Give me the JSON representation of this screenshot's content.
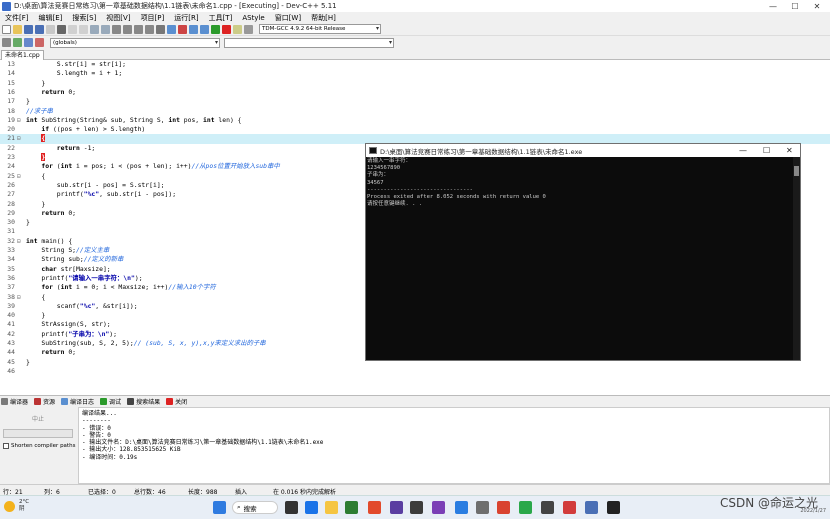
{
  "window": {
    "title": "D:\\桌面\\算法竞赛日常练习\\第一章基础数据结构\\1.1链表\\未命名1.cpp - [Executing] - Dev-C++ 5.11",
    "minimize": "—",
    "maximize": "☐",
    "close": "✕"
  },
  "menu": [
    "文件[F]",
    "编辑[E]",
    "搜索[S]",
    "视图[V]",
    "项目[P]",
    "运行[R]",
    "工具[T]",
    "AStyle",
    "窗口[W]",
    "帮助[H]"
  ],
  "toolbar": {
    "compiler_select": "TDM-GCC 4.9.2 64-bit Release",
    "scope_select": "(globals)"
  },
  "editor_tab": "未命名1.cpp",
  "code_lines": [
    {
      "n": "13",
      "f": "",
      "segs": [
        {
          "t": "        S.str[i] = str[i];",
          "c": ""
        }
      ]
    },
    {
      "n": "14",
      "f": "",
      "segs": [
        {
          "t": "        S.length = i + 1;",
          "c": ""
        }
      ]
    },
    {
      "n": "15",
      "f": "",
      "segs": [
        {
          "t": "    }",
          "c": ""
        }
      ]
    },
    {
      "n": "16",
      "f": "",
      "segs": [
        {
          "t": "    ",
          "c": ""
        },
        {
          "t": "return",
          "c": "kw"
        },
        {
          "t": " 0;",
          "c": ""
        }
      ]
    },
    {
      "n": "17",
      "f": "",
      "segs": [
        {
          "t": "}",
          "c": ""
        }
      ]
    },
    {
      "n": "18",
      "f": "",
      "segs": [
        {
          "t": "//求子串",
          "c": "cm"
        }
      ]
    },
    {
      "n": "19",
      "f": "⊟",
      "segs": [
        {
          "t": "int",
          "c": "kw"
        },
        {
          "t": " SubString(String& sub, String S, ",
          "c": ""
        },
        {
          "t": "int",
          "c": "kw"
        },
        {
          "t": " pos, ",
          "c": ""
        },
        {
          "t": "int",
          "c": "kw"
        },
        {
          "t": " len) {",
          "c": ""
        }
      ]
    },
    {
      "n": "20",
      "f": "",
      "segs": [
        {
          "t": "    ",
          "c": ""
        },
        {
          "t": "if",
          "c": "kw"
        },
        {
          "t": " ((pos + len) > S.length)",
          "c": ""
        }
      ]
    },
    {
      "n": "21",
      "f": "⊟",
      "hl": true,
      "segs": [
        {
          "t": "    ",
          "c": ""
        },
        {
          "t": "{",
          "c": "brace"
        }
      ]
    },
    {
      "n": "22",
      "f": "",
      "segs": [
        {
          "t": "        ",
          "c": ""
        },
        {
          "t": "return",
          "c": "kw"
        },
        {
          "t": " -1;",
          "c": ""
        }
      ]
    },
    {
      "n": "23",
      "f": "",
      "segs": [
        {
          "t": "    ",
          "c": ""
        },
        {
          "t": "}",
          "c": "brace"
        }
      ]
    },
    {
      "n": "24",
      "f": "",
      "segs": [
        {
          "t": "    ",
          "c": ""
        },
        {
          "t": "for",
          "c": "kw"
        },
        {
          "t": " (",
          "c": ""
        },
        {
          "t": "int",
          "c": "kw"
        },
        {
          "t": " i = pos; i < (pos + len); i++)",
          "c": ""
        },
        {
          "t": "//从pos位置开始放入sub串中",
          "c": "cm"
        }
      ]
    },
    {
      "n": "25",
      "f": "⊟",
      "segs": [
        {
          "t": "    {",
          "c": ""
        }
      ]
    },
    {
      "n": "26",
      "f": "",
      "segs": [
        {
          "t": "        sub.str[i - pos] = S.str[i];",
          "c": ""
        }
      ]
    },
    {
      "n": "27",
      "f": "",
      "segs": [
        {
          "t": "        printf(",
          "c": ""
        },
        {
          "t": "\"%c\"",
          "c": "st"
        },
        {
          "t": ", sub.str[i - pos]);",
          "c": ""
        }
      ]
    },
    {
      "n": "28",
      "f": "",
      "segs": [
        {
          "t": "    }",
          "c": ""
        }
      ]
    },
    {
      "n": "29",
      "f": "",
      "segs": [
        {
          "t": "    ",
          "c": ""
        },
        {
          "t": "return",
          "c": "kw"
        },
        {
          "t": " 0;",
          "c": ""
        }
      ]
    },
    {
      "n": "30",
      "f": "",
      "segs": [
        {
          "t": "}",
          "c": ""
        }
      ]
    },
    {
      "n": "31",
      "f": "",
      "segs": [
        {
          "t": "",
          "c": ""
        }
      ]
    },
    {
      "n": "32",
      "f": "⊟",
      "segs": [
        {
          "t": "int",
          "c": "kw"
        },
        {
          "t": " main() {",
          "c": ""
        }
      ]
    },
    {
      "n": "33",
      "f": "",
      "segs": [
        {
          "t": "    String S;",
          "c": ""
        },
        {
          "t": "//定义主串",
          "c": "cm"
        }
      ]
    },
    {
      "n": "34",
      "f": "",
      "segs": [
        {
          "t": "    String sub;",
          "c": ""
        },
        {
          "t": "//定义的新串",
          "c": "cm"
        }
      ]
    },
    {
      "n": "35",
      "f": "",
      "segs": [
        {
          "t": "    ",
          "c": ""
        },
        {
          "t": "char",
          "c": "kw"
        },
        {
          "t": " str[Maxsize];",
          "c": ""
        }
      ]
    },
    {
      "n": "36",
      "f": "",
      "segs": [
        {
          "t": "    printf(",
          "c": ""
        },
        {
          "t": "\"请输入一串字符：\\n\"",
          "c": "st"
        },
        {
          "t": ");",
          "c": ""
        }
      ]
    },
    {
      "n": "37",
      "f": "",
      "segs": [
        {
          "t": "    ",
          "c": ""
        },
        {
          "t": "for",
          "c": "kw"
        },
        {
          "t": " (",
          "c": ""
        },
        {
          "t": "int",
          "c": "kw"
        },
        {
          "t": " i = 0; i < Maxsize; i++)",
          "c": ""
        },
        {
          "t": "//输入10个字符",
          "c": "cm"
        }
      ]
    },
    {
      "n": "38",
      "f": "⊟",
      "segs": [
        {
          "t": "    {",
          "c": ""
        }
      ]
    },
    {
      "n": "39",
      "f": "",
      "segs": [
        {
          "t": "        scanf(",
          "c": ""
        },
        {
          "t": "\"%c\"",
          "c": "st"
        },
        {
          "t": ", &str[i]);",
          "c": ""
        }
      ]
    },
    {
      "n": "40",
      "f": "",
      "segs": [
        {
          "t": "    }",
          "c": ""
        }
      ]
    },
    {
      "n": "41",
      "f": "",
      "segs": [
        {
          "t": "    StrAssign(S, str);",
          "c": ""
        }
      ]
    },
    {
      "n": "42",
      "f": "",
      "segs": [
        {
          "t": "    printf(",
          "c": ""
        },
        {
          "t": "\"子串为：\\n\"",
          "c": "st"
        },
        {
          "t": ");",
          "c": ""
        }
      ]
    },
    {
      "n": "43",
      "f": "",
      "segs": [
        {
          "t": "    SubString(sub, S, 2, 5);",
          "c": ""
        },
        {
          "t": "// (sub, S, x, y),x,y来定义求出的子串",
          "c": "cm"
        }
      ]
    },
    {
      "n": "44",
      "f": "",
      "segs": [
        {
          "t": "    ",
          "c": ""
        },
        {
          "t": "return",
          "c": "kw"
        },
        {
          "t": " 0;",
          "c": ""
        }
      ]
    },
    {
      "n": "45",
      "f": "",
      "segs": [
        {
          "t": "}",
          "c": ""
        }
      ]
    },
    {
      "n": "46",
      "f": "",
      "segs": [
        {
          "t": "",
          "c": ""
        }
      ]
    }
  ],
  "console": {
    "title": "D:\\桌面\\算法竞赛日常练习\\第一章基础数据结构\\1.1链表\\未命名1.exe",
    "output": "请输入一串字符：\n1234567890\n子串为：\n34567\n--------------------------------\nProcess exited after 8.052 seconds with return value 0\n请按任意键继续. . ."
  },
  "bottom_tabs": [
    "编译器",
    "资源",
    "编译日志",
    "调试",
    "搜索结果",
    "关闭"
  ],
  "left_panel": {
    "stop_button": "中止",
    "shorten_paths": "Shorten compiler paths"
  },
  "compile_log": "编译结果...\n--------\n- 错误：0\n- 警告：0\n- 输出文件名：D:\\桌面\\算法竞赛日常练习\\第一章基础数据结构\\1.1链表\\未命名1.exe\n- 输出大小：128.853515625 KiB\n- 编译时间：0.19s",
  "status": {
    "row": "行：21",
    "col": "列：6",
    "selected": "已选择：0",
    "total_lines": "总行数：46",
    "length": "长度：988",
    "insert": "插入",
    "parse_time": "在 0.016 秒内完成解析"
  },
  "taskbar": {
    "temperature": "2°C",
    "weather": "阴",
    "search_label": "搜索",
    "watermark": "CSDN @命运之光",
    "date": "2022/1/27"
  },
  "colors": {
    "keyword": "#000000",
    "comment": "#1e64dc",
    "string": "#0000aa",
    "highlight_line": "#cfeff8",
    "brace_match": "#e02020",
    "console_bg": "#0c0c0c"
  }
}
